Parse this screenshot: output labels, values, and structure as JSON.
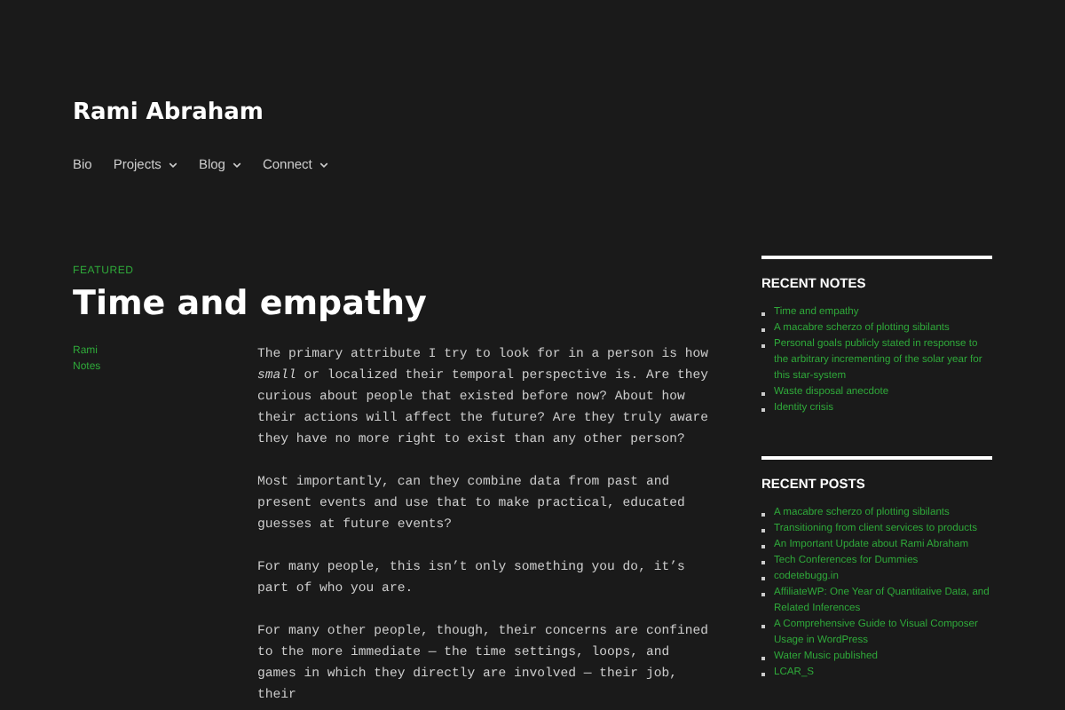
{
  "site_title": "Rami Abraham",
  "nav": [
    {
      "label": "Bio",
      "has_submenu": false
    },
    {
      "label": "Projects",
      "has_submenu": true
    },
    {
      "label": "Blog",
      "has_submenu": true
    },
    {
      "label": "Connect",
      "has_submenu": true
    }
  ],
  "post": {
    "badge": "FEATURED",
    "title": "Time and empathy",
    "meta": [
      "Rami",
      "Notes"
    ],
    "paragraphs": [
      "The primary attribute I try to look for in a person is how *small* or localized their temporal perspective is. Are they curious about people that existed before now? About how their actions will affect the future? Are they truly aware they have no more right to exist than any other person?",
      "Most importantly, can they combine data from past and present events and use that to make practical, educated guesses at future events?",
      "For many people, this isn’t only something you do, it’s part of who you are.",
      "For many other people, though, their concerns are confined to the more immediate — the time settings, loops, and games in which they directly are involved — their job, their"
    ]
  },
  "widgets": [
    {
      "title": "RECENT NOTES",
      "items": [
        "Time and empathy",
        "A macabre scherzo of plotting sibilants",
        "Personal goals publicly stated in response to the arbitrary incrementing of the solar year for this star-system",
        "Waste disposal anecdote",
        "Identity crisis"
      ]
    },
    {
      "title": "RECENT POSTS",
      "items": [
        "A macabre scherzo of plotting sibilants",
        "Transitioning from client services to products",
        "An Important Update about Rami Abraham",
        "Tech Conferences for Dummies",
        "codetebugg.in",
        "AffiliateWP: One Year of Quantitative Data, and Related Inferences",
        "A Comprehensive Guide to Visual Composer Usage in WordPress",
        "Water Music published",
        "LCAR_S"
      ]
    }
  ]
}
